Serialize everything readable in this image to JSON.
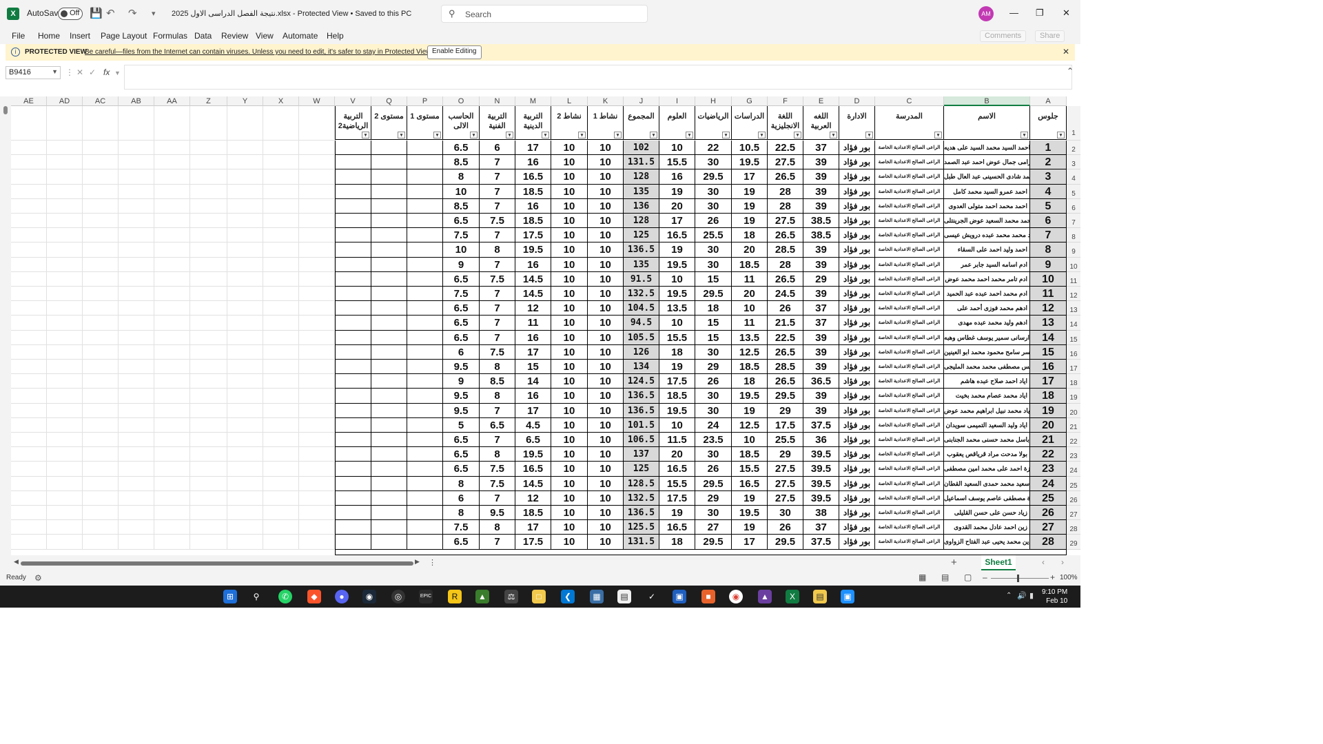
{
  "app": {
    "autosave_label": "AutoSave",
    "autosave_state": "Off",
    "title": "نتيجة الفصل الدراسى الاول 2025.xlsx  -  Protected View  •  Saved to this PC",
    "search_placeholder": "Search",
    "avatar_initials": "AM",
    "brand_color": "#107c41"
  },
  "menu": [
    "File",
    "Home",
    "Insert",
    "Page Layout",
    "Formulas",
    "Data",
    "Review",
    "View",
    "Automate",
    "Help"
  ],
  "ribbon_right": {
    "comments": "Comments",
    "share": "Share"
  },
  "protected_view": {
    "label": "PROTECTED VIEW",
    "message": "Be careful—files from the Internet can contain viruses. Unless you need to edit, it's safer to stay in Protected View.",
    "button": "Enable Editing"
  },
  "formula_bar": {
    "name_box": "B9416",
    "fx": "fx",
    "value": ""
  },
  "column_letters": [
    "AE",
    "AD",
    "AC",
    "AB",
    "AA",
    "Z",
    "Y",
    "X",
    "W",
    "V",
    "Q",
    "P",
    "O",
    "N",
    "M",
    "L",
    "K",
    "J",
    "I",
    "H",
    "G",
    "F",
    "E",
    "D",
    "C",
    "B",
    "A"
  ],
  "headers": {
    "V": "التربية الرياضية2",
    "Q": "مستوى 2",
    "P": "مستوى 1",
    "O": "الحاسب الالى",
    "N": "التربية الفنية",
    "M": "التربية الدينية",
    "L": "نشاط 2",
    "K": "نشاط 1",
    "J": "المجموع",
    "I": "العلوم",
    "H": "الرياضيات",
    "G": "الدراسات",
    "F": "اللغة الانجليزية",
    "E": "اللغه العربية",
    "D": "الادارة",
    "C": "المدرسة",
    "B": "الاسم",
    "A": "جلوس"
  },
  "school": "الراعى الصالح الاعدادية الخاصة",
  "admin": "بور فؤاد",
  "rows": [
    {
      "A": "1",
      "B": "احمد السيد محمد السيد على هديه",
      "E": "37",
      "F": "22.5",
      "G": "10.5",
      "H": "22",
      "I": "10",
      "J": "102",
      "K": "10",
      "L": "10",
      "M": "17",
      "N": "6",
      "O": "6.5"
    },
    {
      "A": "2",
      "B": "احمد رامى جمال عوض احمد عبد الصمد",
      "E": "39",
      "F": "27.5",
      "G": "19.5",
      "H": "30",
      "I": "15.5",
      "J": "131.5",
      "K": "10",
      "L": "10",
      "M": "16",
      "N": "7",
      "O": "8.5"
    },
    {
      "A": "3",
      "B": "احمد شادى الحسينى عبد العال طبل",
      "E": "39",
      "F": "26.5",
      "G": "17",
      "H": "29.5",
      "I": "16",
      "J": "128",
      "K": "10",
      "L": "10",
      "M": "16.5",
      "N": "7",
      "O": "8"
    },
    {
      "A": "4",
      "B": "احمد عمرو السيد محمد كامل",
      "E": "39",
      "F": "28",
      "G": "19",
      "H": "30",
      "I": "19",
      "J": "135",
      "K": "10",
      "L": "10",
      "M": "18.5",
      "N": "7",
      "O": "10"
    },
    {
      "A": "5",
      "B": "احمد محمد احمد متولى العدوى",
      "E": "39",
      "F": "28",
      "G": "19",
      "H": "30",
      "I": "20",
      "J": "136",
      "K": "10",
      "L": "10",
      "M": "16",
      "N": "7",
      "O": "8.5"
    },
    {
      "A": "6",
      "B": "احمد محمد السعيد عوض الجرينتلى",
      "E": "38.5",
      "F": "27.5",
      "G": "19",
      "H": "26",
      "I": "17",
      "J": "128",
      "K": "10",
      "L": "10",
      "M": "18.5",
      "N": "7.5",
      "O": "6.5"
    },
    {
      "A": "7",
      "B": "احمد محمد محمد عبده درويش عيسى",
      "E": "38.5",
      "F": "26.5",
      "G": "18",
      "H": "25.5",
      "I": "16.5",
      "J": "125",
      "K": "10",
      "L": "10",
      "M": "17.5",
      "N": "7",
      "O": "7.5"
    },
    {
      "A": "8",
      "B": "احمد وليد احمد على السقاء",
      "E": "39",
      "F": "28.5",
      "G": "20",
      "H": "30",
      "I": "19",
      "J": "136.5",
      "K": "10",
      "L": "10",
      "M": "19.5",
      "N": "8",
      "O": "10"
    },
    {
      "A": "9",
      "B": "ادم اسامه السيد جابر عمر",
      "E": "39",
      "F": "28",
      "G": "18.5",
      "H": "30",
      "I": "19.5",
      "J": "135",
      "K": "10",
      "L": "10",
      "M": "16",
      "N": "7",
      "O": "9"
    },
    {
      "A": "10",
      "B": "ادم تامر محمد احمد محمد عوض",
      "E": "29",
      "F": "26.5",
      "G": "11",
      "H": "15",
      "I": "10",
      "J": "91.5",
      "K": "10",
      "L": "10",
      "M": "14.5",
      "N": "7.5",
      "O": "6.5"
    },
    {
      "A": "11",
      "B": "ادم محمد احمد عبده عبد الحميد",
      "E": "39",
      "F": "24.5",
      "G": "20",
      "H": "29.5",
      "I": "19.5",
      "J": "132.5",
      "K": "10",
      "L": "10",
      "M": "14.5",
      "N": "7",
      "O": "7.5"
    },
    {
      "A": "12",
      "B": "ادهم محمد فوزى أحمد على",
      "E": "37",
      "F": "26",
      "G": "10",
      "H": "18",
      "I": "13.5",
      "J": "104.5",
      "K": "10",
      "L": "10",
      "M": "12",
      "N": "7",
      "O": "6.5"
    },
    {
      "A": "13",
      "B": "ادهم وليد محمد عبده مهدى",
      "E": "37",
      "F": "21.5",
      "G": "11",
      "H": "15",
      "I": "10",
      "J": "94.5",
      "K": "10",
      "L": "10",
      "M": "11",
      "N": "7",
      "O": "6.5"
    },
    {
      "A": "14",
      "B": "ارسانى سمير يوسف غطاس وهبه",
      "E": "39",
      "F": "22.5",
      "G": "13.5",
      "H": "15",
      "I": "15.5",
      "J": "105.5",
      "K": "10",
      "L": "10",
      "M": "16",
      "N": "7",
      "O": "6.5"
    },
    {
      "A": "15",
      "B": "اسر سامح محمود محمد ابو العينين",
      "E": "39",
      "F": "26.5",
      "G": "12.5",
      "H": "30",
      "I": "18",
      "J": "126",
      "K": "10",
      "L": "10",
      "M": "17",
      "N": "7.5",
      "O": "6"
    },
    {
      "A": "16",
      "B": "انس مصطفى محمد محمد المليجى",
      "E": "39",
      "F": "28.5",
      "G": "18.5",
      "H": "29",
      "I": "19",
      "J": "134",
      "K": "10",
      "L": "10",
      "M": "15",
      "N": "8",
      "O": "9.5"
    },
    {
      "A": "17",
      "B": "اياد احمد صلاح عبده هاشم",
      "E": "36.5",
      "F": "26.5",
      "G": "18",
      "H": "26",
      "I": "17.5",
      "J": "124.5",
      "K": "10",
      "L": "10",
      "M": "14",
      "N": "8.5",
      "O": "9"
    },
    {
      "A": "18",
      "B": "اياد محمد عصام محمد بخيت",
      "E": "39",
      "F": "29.5",
      "G": "19.5",
      "H": "30",
      "I": "18.5",
      "J": "136.5",
      "K": "10",
      "L": "10",
      "M": "16",
      "N": "8",
      "O": "9.5"
    },
    {
      "A": "19",
      "B": "اياد محمد نبيل ابراهيم محمد عوض",
      "E": "39",
      "F": "29",
      "G": "19",
      "H": "30",
      "I": "19.5",
      "J": "136.5",
      "K": "10",
      "L": "10",
      "M": "17",
      "N": "7",
      "O": "9.5"
    },
    {
      "A": "20",
      "B": "اياد وليد السعيد التميمى سويدان",
      "E": "37.5",
      "F": "17.5",
      "G": "12.5",
      "H": "24",
      "I": "10",
      "J": "101.5",
      "K": "10",
      "L": "10",
      "M": "4.5",
      "N": "6.5",
      "O": "5"
    },
    {
      "A": "21",
      "B": "باسل محمد حسنى محمد الجنابنى",
      "E": "36",
      "F": "25.5",
      "G": "10",
      "H": "23.5",
      "I": "11.5",
      "J": "106.5",
      "K": "10",
      "L": "10",
      "M": "6.5",
      "N": "7",
      "O": "6.5"
    },
    {
      "A": "22",
      "B": "بولا مدحت مراد قرياقص يعقوب",
      "E": "39.5",
      "F": "29",
      "G": "18.5",
      "H": "30",
      "I": "20",
      "J": "137",
      "K": "10",
      "L": "10",
      "M": "19.5",
      "N": "8",
      "O": "6.5"
    },
    {
      "A": "23",
      "B": "حمزة احمد على محمد امين مصطفى",
      "E": "39.5",
      "F": "27.5",
      "G": "15.5",
      "H": "26",
      "I": "16.5",
      "J": "125",
      "K": "10",
      "L": "10",
      "M": "16.5",
      "N": "7.5",
      "O": "6.5"
    },
    {
      "A": "24",
      "B": "حمزة سعيد محمد حمدى السعيد القطان",
      "E": "39.5",
      "F": "27.5",
      "G": "16.5",
      "H": "29.5",
      "I": "15.5",
      "J": "128.5",
      "K": "10",
      "L": "10",
      "M": "14.5",
      "N": "7.5",
      "O": "8"
    },
    {
      "A": "25",
      "B": "حمزة مصطفى عاصم يوسف اسماعيل",
      "E": "39.5",
      "F": "27.5",
      "G": "19",
      "H": "29",
      "I": "17.5",
      "J": "132.5",
      "K": "10",
      "L": "10",
      "M": "12",
      "N": "7",
      "O": "6"
    },
    {
      "A": "26",
      "B": "زياد حسن على حسن القليلى",
      "E": "38",
      "F": "30",
      "G": "19.5",
      "H": "30",
      "I": "19",
      "J": "136.5",
      "K": "10",
      "L": "10",
      "M": "18.5",
      "N": "9.5",
      "O": "8"
    },
    {
      "A": "27",
      "B": "زين احمد عادل محمد القدوى",
      "E": "37",
      "F": "26",
      "G": "19",
      "H": "27",
      "I": "16.5",
      "J": "125.5",
      "K": "10",
      "L": "10",
      "M": "17",
      "N": "8",
      "O": "7.5"
    },
    {
      "A": "28",
      "B": "زين الدين محمد يحيى عبد الفتاح الزواوى",
      "E": "37.5",
      "F": "29.5",
      "G": "17",
      "H": "29.5",
      "I": "18",
      "J": "131.5",
      "K": "10",
      "L": "10",
      "M": "17.5",
      "N": "7",
      "O": "6.5"
    }
  ],
  "row_numbers": [
    "1",
    "2",
    "3",
    "4",
    "5",
    "6",
    "7",
    "8",
    "9",
    "10",
    "11",
    "12",
    "13",
    "14",
    "15",
    "16",
    "17",
    "18",
    "19",
    "20",
    "21",
    "22",
    "23",
    "24",
    "25",
    "26",
    "27",
    "28",
    "29"
  ],
  "sheet_tab": "Sheet1",
  "status": {
    "ready": "Ready",
    "zoom": "100%"
  },
  "clock": {
    "time": "9:10 PM",
    "date": "Feb 10"
  }
}
